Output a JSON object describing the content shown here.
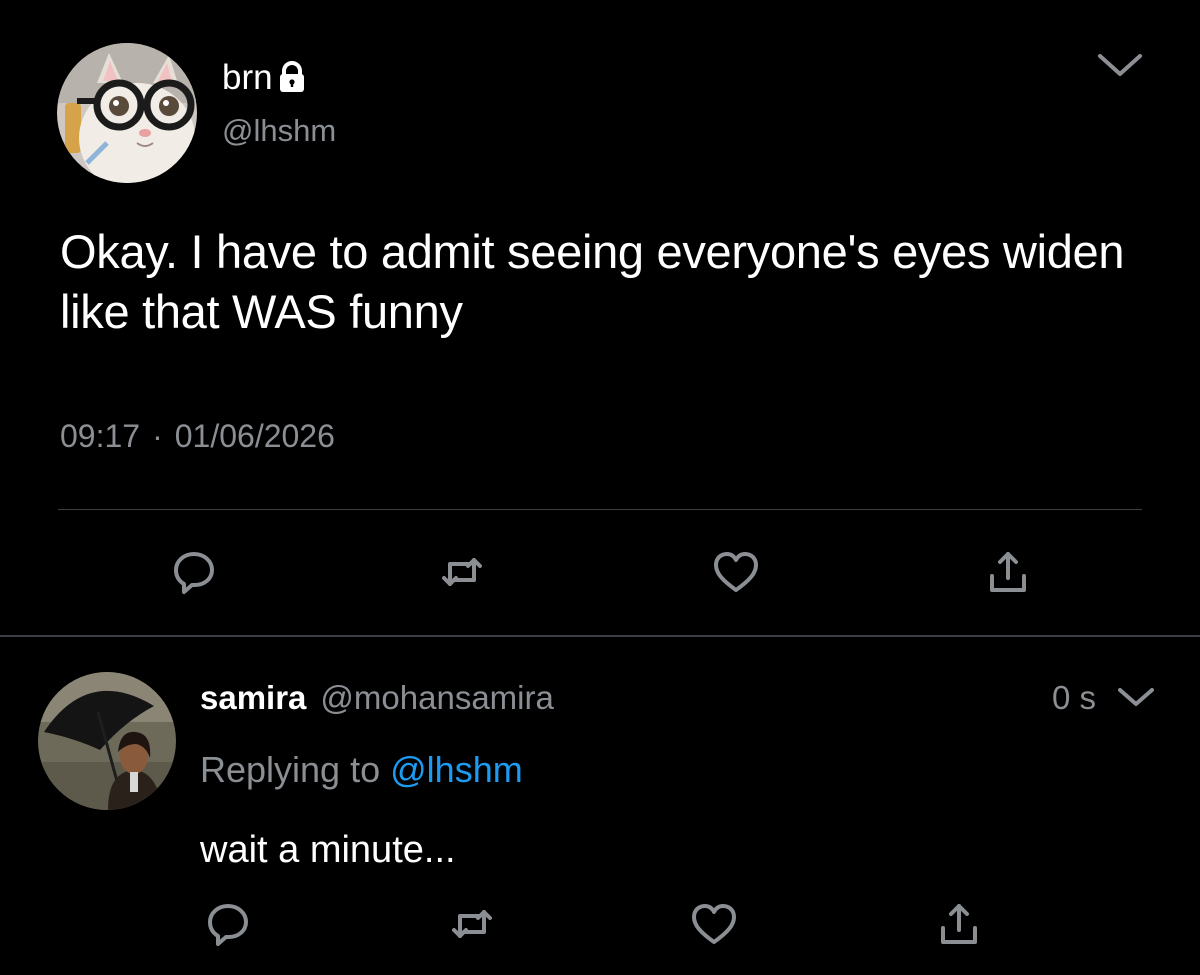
{
  "main_tweet": {
    "display_name": "brn",
    "handle": "@lhshm",
    "text": "Okay. I have to admit seeing everyone's eyes widen like that WAS funny",
    "time": "09:17",
    "separator": "·",
    "date": "01/06/2026",
    "icons": {
      "lock": "lock-icon",
      "menu": "chevron-down-icon",
      "reply": "reply-icon",
      "retweet": "retweet-icon",
      "like": "heart-icon",
      "share": "share-icon"
    }
  },
  "reply_tweet": {
    "display_name": "samira",
    "handle": "@mohansamira",
    "time": "0 s",
    "replying_label": "Replying to",
    "replying_to": "@lhshm",
    "text": "wait a minute...",
    "icons": {
      "menu": "chevron-down-icon",
      "reply": "reply-icon",
      "retweet": "retweet-icon",
      "like": "heart-icon",
      "share": "share-icon"
    }
  },
  "colors": {
    "background": "#000000",
    "primary_text": "#ffffff",
    "secondary_text": "#8b8f94",
    "link": "#1d9bf0",
    "divider": "#3a3d41"
  }
}
